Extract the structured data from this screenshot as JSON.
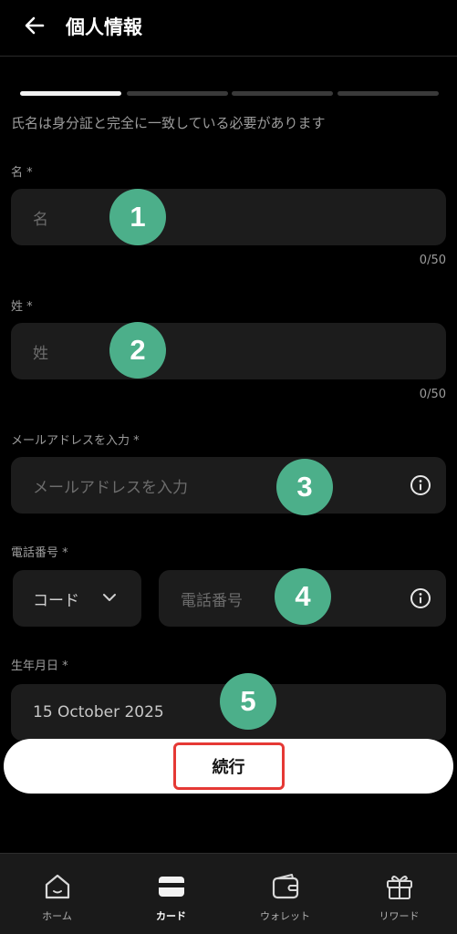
{
  "header": {
    "title": "個人情報"
  },
  "progress": {
    "steps": 4,
    "current": 1
  },
  "note": "氏名は身分証と完全に一致している必要があります",
  "first_name": {
    "label": "名 *",
    "placeholder": "名",
    "counter": "0/50",
    "badge": "1"
  },
  "last_name": {
    "label": "姓 *",
    "placeholder": "姓",
    "counter": "0/50",
    "badge": "2"
  },
  "email": {
    "label": "メールアドレスを入力 *",
    "placeholder": "メールアドレスを入力",
    "badge": "3"
  },
  "phone": {
    "label": "電話番号 *",
    "code_value": "コード",
    "placeholder": "電話番号",
    "badge": "4"
  },
  "birthdate": {
    "label": "生年月日 *",
    "value": "15 October 2025",
    "badge": "5"
  },
  "continue_label": "続行",
  "nav": {
    "items": [
      {
        "label": "ホーム",
        "icon": "home-icon"
      },
      {
        "label": "カード",
        "icon": "card-icon"
      },
      {
        "label": "ウォレット",
        "icon": "wallet-icon"
      },
      {
        "label": "リワード",
        "icon": "gift-icon"
      }
    ],
    "active": "カード"
  },
  "colors": {
    "badge": "#4caf8a",
    "highlight": "#e53935",
    "background": "#000000",
    "field": "#1c1c1c"
  }
}
